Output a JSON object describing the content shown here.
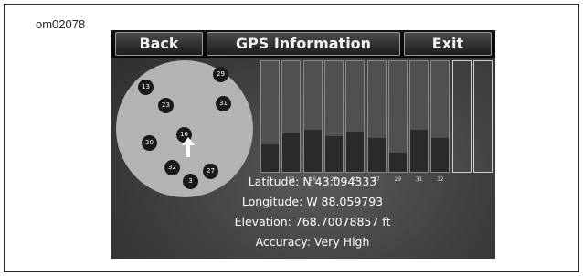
{
  "document": {
    "id": "om02078"
  },
  "header": {
    "back_label": "Back",
    "title": "GPS Information",
    "exit_label": "Exit"
  },
  "sky_plot": {
    "satellites": [
      "29",
      "13",
      "23",
      "31",
      "20",
      "16",
      "32",
      "27",
      "3"
    ]
  },
  "signal_bars": {
    "satellites": [
      {
        "label": "3",
        "level": 0.24
      },
      {
        "label": "13",
        "level": 0.34
      },
      {
        "label": "16",
        "level": 0.37
      },
      {
        "label": "20",
        "level": 0.32
      },
      {
        "label": "23",
        "level": 0.36
      },
      {
        "label": "27",
        "level": 0.3
      },
      {
        "label": "29",
        "level": 0.17
      },
      {
        "label": "31",
        "level": 0.37
      },
      {
        "label": "32",
        "level": 0.3
      },
      {
        "label": "",
        "level": 0
      },
      {
        "label": "",
        "level": 0
      }
    ]
  },
  "info": {
    "latitude": "Latitude: N 43.094333",
    "longitude": "Longitude: W 88.059793",
    "elevation": "Elevation: 768.70078857 ft",
    "accuracy": "Accuracy: Very High"
  },
  "colors": {
    "screen_bg": "#3e3e3e",
    "sky_disc": "#b3b3b3",
    "satellite": "#1a1a1a",
    "text": "#ffffff"
  }
}
